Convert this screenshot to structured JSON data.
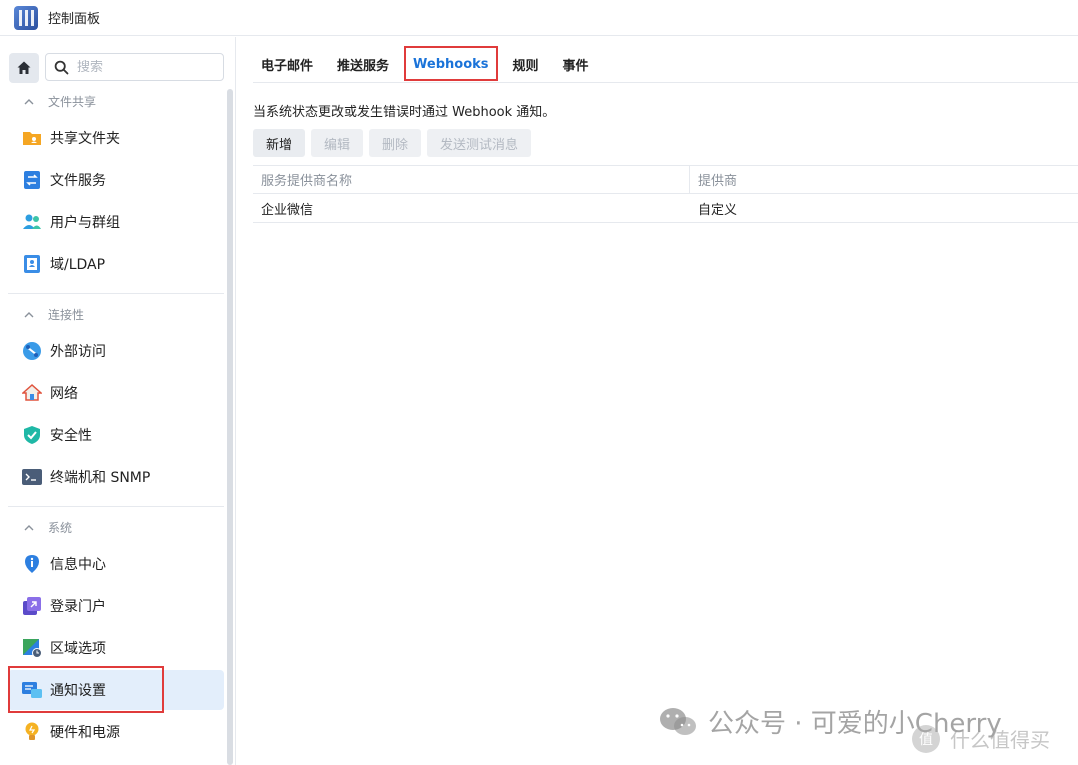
{
  "window": {
    "title": "控制面板"
  },
  "sidebar": {
    "search_placeholder": "搜索",
    "sections": {
      "file_sharing": "文件共享",
      "connectivity": "连接性",
      "system": "系统"
    },
    "items": {
      "shared_folder": "共享文件夹",
      "file_services": "文件服务",
      "users_groups": "用户与群组",
      "domain_ldap": "域/LDAP",
      "external_access": "外部访问",
      "network": "网络",
      "security": "安全性",
      "terminal_snmp": "终端机和 SNMP",
      "info_center": "信息中心",
      "login_portal": "登录门户",
      "regional_options": "区域选项",
      "notification": "通知设置",
      "hardware_power": "硬件和电源"
    }
  },
  "main": {
    "tabs": [
      "电子邮件",
      "推送服务",
      "Webhooks",
      "规则",
      "事件"
    ],
    "active_tab": "Webhooks",
    "description": "当系统状态更改或发生错误时通过 Webhook 通知。",
    "toolbar": {
      "add": "新增",
      "edit": "编辑",
      "delete": "删除",
      "send_test": "发送测试消息"
    },
    "table": {
      "headers": [
        "服务提供商名称",
        "提供商"
      ],
      "rows": [
        [
          "企业微信",
          "自定义"
        ]
      ]
    }
  },
  "watermark": {
    "main": "公众号 · 可爱的小Cherry",
    "secondary": "什么值得买",
    "secondary_badge": "值"
  }
}
